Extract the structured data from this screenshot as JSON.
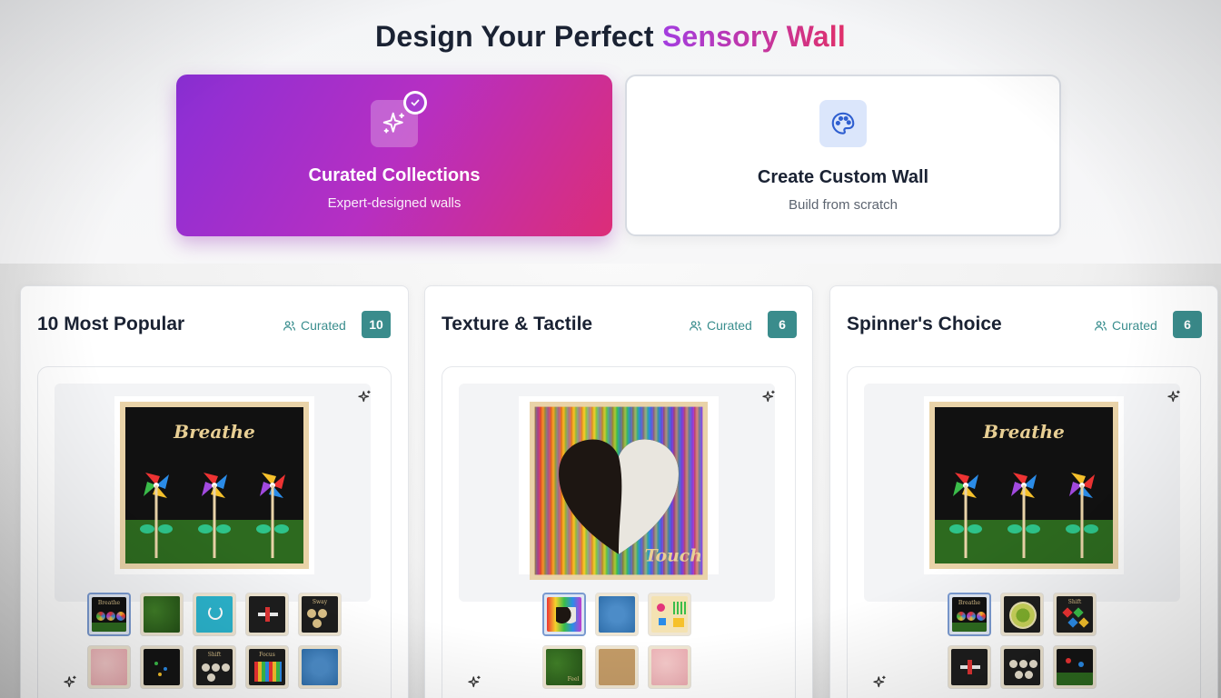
{
  "header": {
    "title_main": "Design Your Perfect ",
    "title_accent": "Sensory Wall"
  },
  "modes": [
    {
      "title": "Curated Collections",
      "subtitle": "Expert-designed walls",
      "icon": "sparkles-icon",
      "selected": true
    },
    {
      "title": "Create Custom Wall",
      "subtitle": "Build from scratch",
      "icon": "palette-icon",
      "selected": false
    }
  ],
  "collections": [
    {
      "title": "10 Most Popular",
      "tag": "Curated",
      "count": "10",
      "hero": {
        "type": "pinwheels",
        "text": "Breathe"
      },
      "thumbs": [
        {
          "kind": "pinwheels",
          "label": "Breathe",
          "selected": true
        },
        {
          "kind": "moss",
          "label": ""
        },
        {
          "kind": "smiley",
          "label": ""
        },
        {
          "kind": "plane",
          "label": ""
        },
        {
          "kind": "coins",
          "label": "Sway"
        },
        {
          "kind": "pink",
          "label": ""
        },
        {
          "kind": "dark-dots",
          "label": ""
        },
        {
          "kind": "coins-dark",
          "label": "Shift"
        },
        {
          "kind": "abacus",
          "label": "Focus"
        },
        {
          "kind": "blue-texture",
          "label": ""
        }
      ]
    },
    {
      "title": "Texture & Tactile",
      "tag": "Curated",
      "count": "6",
      "hero": {
        "type": "heart",
        "text": "Touch"
      },
      "thumbs": [
        {
          "kind": "heart",
          "label": "",
          "selected": true
        },
        {
          "kind": "blue-texture",
          "label": ""
        },
        {
          "kind": "flowers",
          "label": ""
        },
        {
          "kind": "moss",
          "label": "Feel"
        },
        {
          "kind": "cork",
          "label": ""
        },
        {
          "kind": "pink",
          "label": ""
        }
      ]
    },
    {
      "title": "Spinner's Choice",
      "tag": "Curated",
      "count": "6",
      "hero": {
        "type": "pinwheels",
        "text": "Breathe"
      },
      "thumbs": [
        {
          "kind": "pinwheels",
          "label": "Breathe",
          "selected": true
        },
        {
          "kind": "spinner-disc",
          "label": ""
        },
        {
          "kind": "diamonds",
          "label": "Shift"
        },
        {
          "kind": "plane",
          "label": ""
        },
        {
          "kind": "coins-dark",
          "label": ""
        },
        {
          "kind": "garden",
          "label": ""
        }
      ]
    }
  ],
  "colors": {
    "accent_purple": "#8b2fd6",
    "accent_pink": "#dc2d78",
    "teal": "#3a8c8c",
    "text_dark": "#1a2233"
  }
}
